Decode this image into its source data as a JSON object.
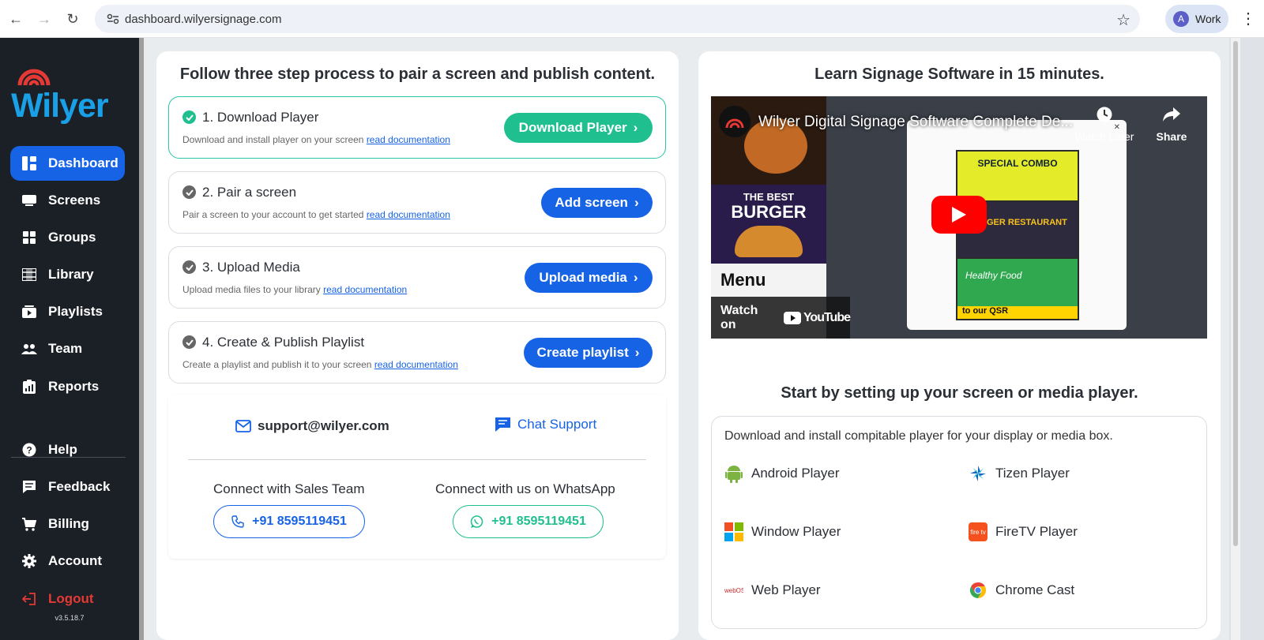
{
  "browser": {
    "url": "dashboard.wilyersignage.com",
    "profile_initial": "A",
    "profile_label": "Work"
  },
  "sidebar": {
    "logo_text": "Wilyer",
    "items": [
      {
        "label": "Dashboard",
        "icon": "dashboard-icon",
        "active": true
      },
      {
        "label": "Screens",
        "icon": "screen-icon"
      },
      {
        "label": "Groups",
        "icon": "grid-icon"
      },
      {
        "label": "Library",
        "icon": "film-icon"
      },
      {
        "label": "Playlists",
        "icon": "playlist-icon"
      },
      {
        "label": "Team",
        "icon": "team-icon"
      },
      {
        "label": "Reports",
        "icon": "report-icon"
      }
    ],
    "bottom_items": [
      {
        "label": "Help",
        "icon": "help-icon"
      },
      {
        "label": "Feedback",
        "icon": "feedback-icon"
      },
      {
        "label": "Billing",
        "icon": "cart-icon"
      },
      {
        "label": "Account",
        "icon": "gear-icon"
      },
      {
        "label": "Logout",
        "icon": "logout-icon"
      }
    ],
    "version": "v3.5.18.7"
  },
  "steps_card": {
    "title": "Follow three step process to pair a screen and publish content.",
    "read_doc": "read documentation",
    "steps": [
      {
        "title": "1. Download Player",
        "desc": "Download and install player on your screen",
        "button": "Download Player"
      },
      {
        "title": "2. Pair a screen",
        "desc": "Pair a screen to your account to get started",
        "button": "Add screen"
      },
      {
        "title": "3. Upload Media",
        "desc": "Upload media files to your library",
        "button": "Upload media"
      },
      {
        "title": "4. Create & Publish Playlist",
        "desc": "Create a playlist and publish it to your screen",
        "button": "Create playlist"
      }
    ]
  },
  "support": {
    "email": "support@wilyer.com",
    "chat": "Chat Support",
    "sales_label": "Connect with Sales Team",
    "sales_phone": "+91 8595119451",
    "whatsapp_label": "Connect with us on WhatsApp",
    "whatsapp_phone": "+91 8595119451"
  },
  "video_card": {
    "title": "Learn Signage Software in 15 minutes.",
    "video_title": "Wilyer Digital Signage Software Complete De...",
    "watch_later": "Watch Later",
    "share": "Share",
    "watch_on": "Watch on",
    "youtube": "YouTube",
    "thumb_texts": [
      "THE BEST",
      "BURGER",
      "Menu",
      "SPECIAL COMBO",
      "BURGER RESTAURANT",
      "Healthy Food",
      "to our QSR"
    ]
  },
  "players_card": {
    "title": "Start by setting up your screen or media player.",
    "desc": "Download and install compitable player for your display or media box.",
    "players": [
      {
        "label": "Android Player",
        "icon": "android-icon",
        "color": "#7cb342"
      },
      {
        "label": "Tizen Player",
        "icon": "tizen-icon",
        "color": "#1565c0"
      },
      {
        "label": "Window Player",
        "icon": "windows-icon",
        "color": "#f25022"
      },
      {
        "label": "FireTV Player",
        "icon": "firetv-icon",
        "color": "#f4511e"
      },
      {
        "label": "Web Player",
        "icon": "webos-icon",
        "color": "#c62828"
      },
      {
        "label": "Chrome Cast",
        "icon": "chrome-icon",
        "color": "#4285f4"
      }
    ]
  },
  "colors": {
    "primary": "#1663e6",
    "success": "#1fbf8f",
    "sidebar": "#1b1f26"
  }
}
